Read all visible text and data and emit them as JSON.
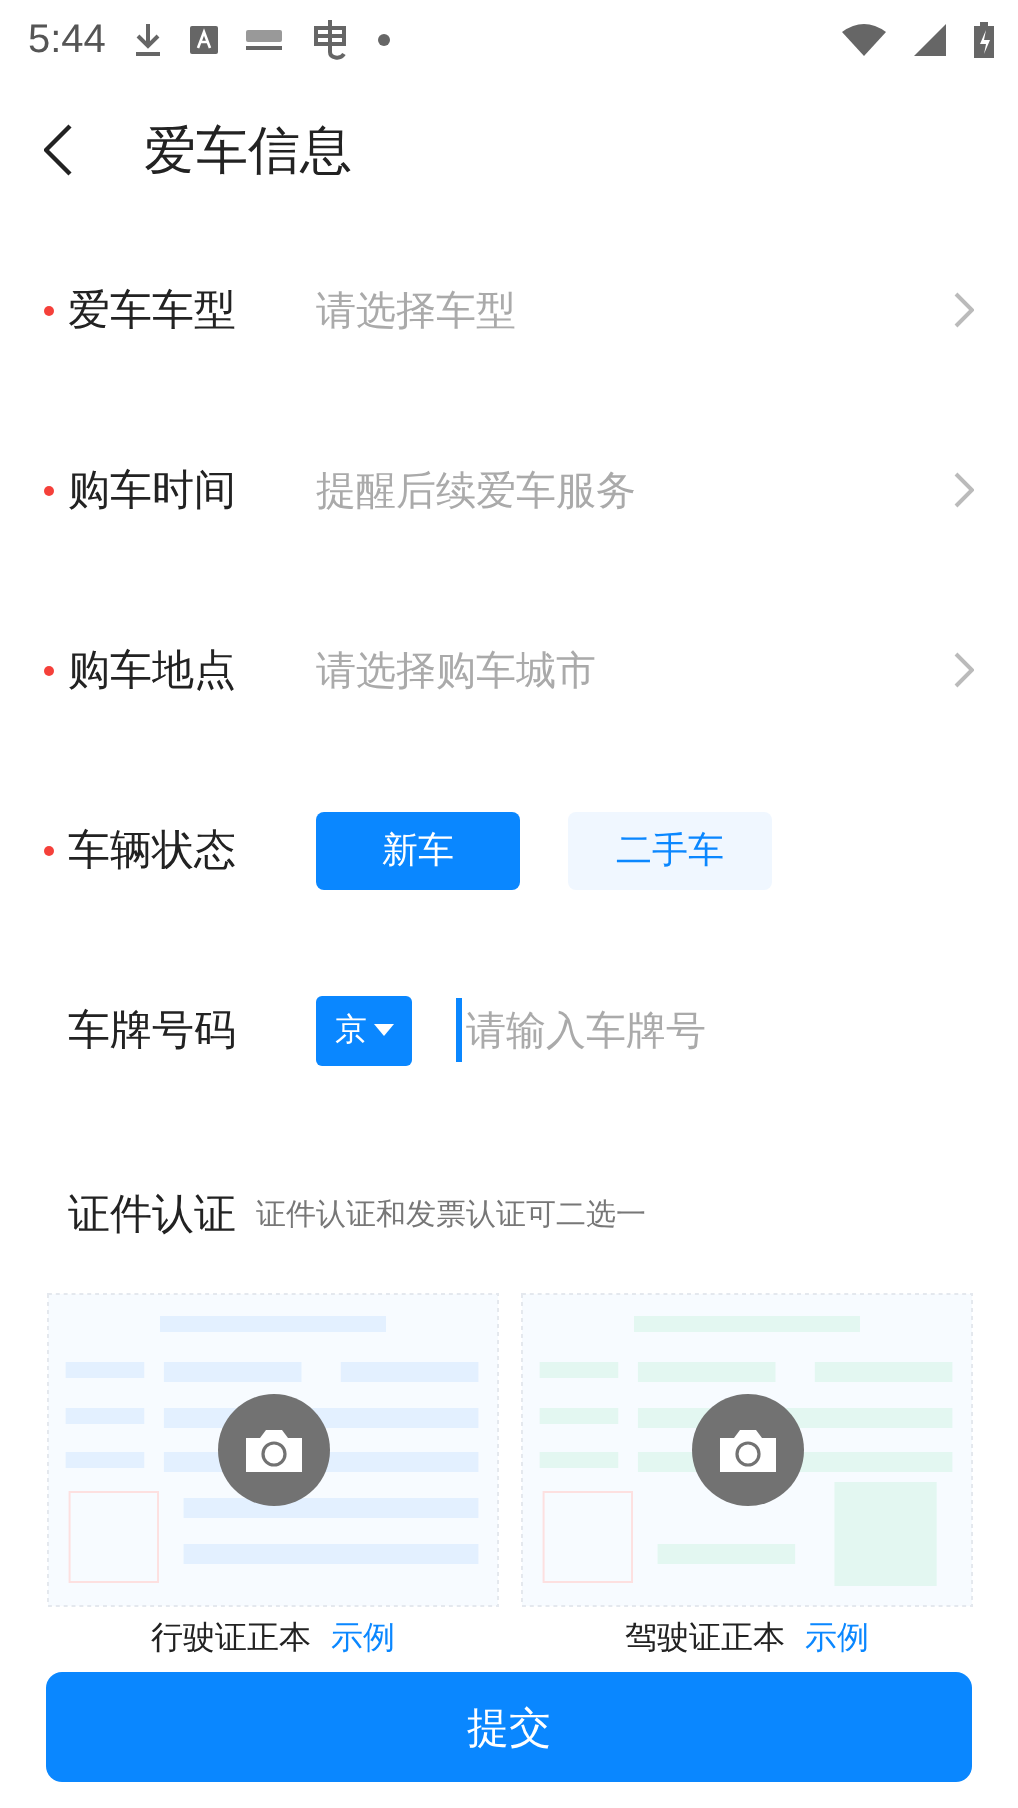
{
  "status_bar": {
    "time": "5:44"
  },
  "header": {
    "title": "爱车信息"
  },
  "fields": [
    {
      "kind": "select",
      "label": "爱车车型",
      "required": true,
      "placeholder": "请选择车型"
    },
    {
      "kind": "select",
      "label": "购车时间",
      "required": true,
      "placeholder": "提醒后续爱车服务"
    },
    {
      "kind": "select",
      "label": "购车地点",
      "required": true,
      "placeholder": "请选择购车城市"
    },
    {
      "kind": "choice",
      "label": "车辆状态",
      "required": true,
      "options": [
        {
          "label": "新车",
          "selected": true
        },
        {
          "label": "二手车",
          "selected": false
        }
      ]
    },
    {
      "kind": "plate",
      "label": "车牌号码",
      "required": false,
      "province": "京",
      "placeholder": "请输入车牌号"
    }
  ],
  "certification": {
    "title": "证件认证",
    "hint": "证件认证和发票认证可二选一",
    "cards": [
      {
        "kind": "picture",
        "caption": "行驶证正本",
        "link": "示例"
      },
      {
        "kind": "picture",
        "caption": "驾驶证正本",
        "link": "示例"
      }
    ]
  },
  "submit": {
    "label": "提交"
  }
}
